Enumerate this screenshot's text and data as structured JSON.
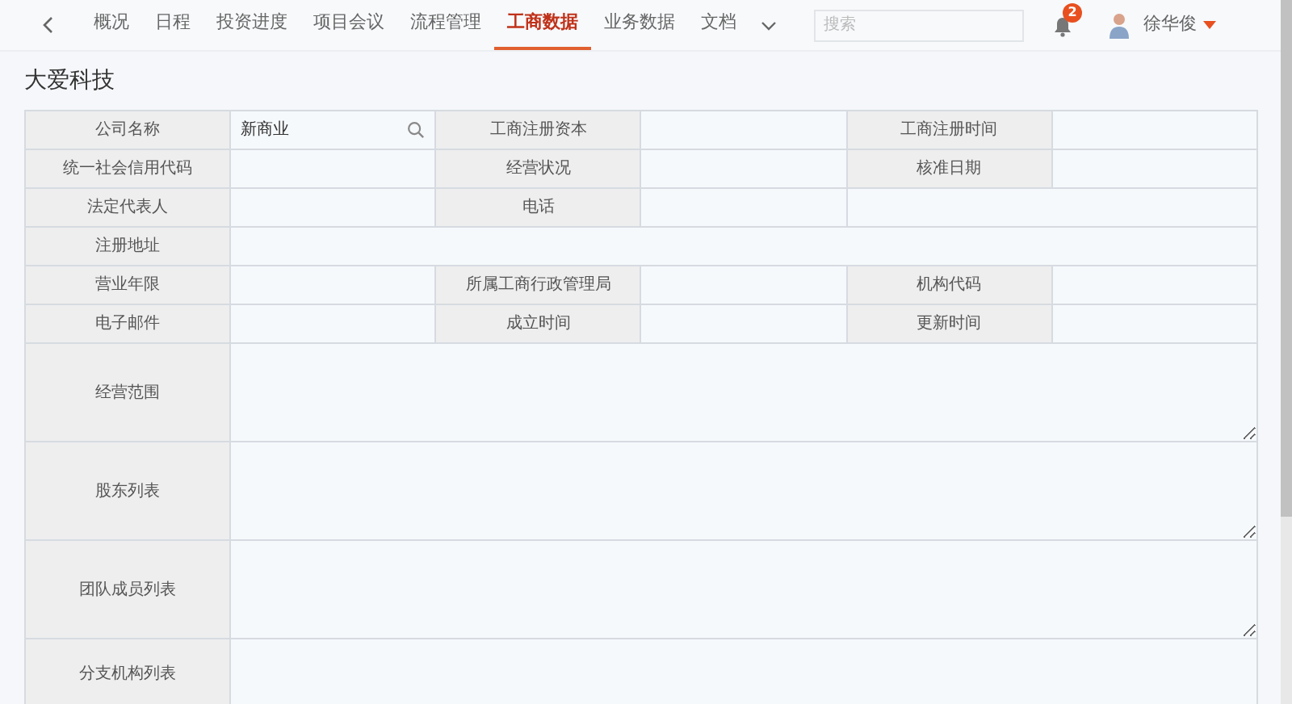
{
  "nav": {
    "tabs": [
      {
        "label": "概况",
        "selected": false
      },
      {
        "label": "日程",
        "selected": false
      },
      {
        "label": "投资进度",
        "selected": false
      },
      {
        "label": "项目会议",
        "selected": false
      },
      {
        "label": "流程管理",
        "selected": false
      },
      {
        "label": "工商数据",
        "selected": true
      },
      {
        "label": "业务数据",
        "selected": false
      },
      {
        "label": "文档",
        "selected": false
      }
    ],
    "search": {
      "placeholder": "搜索"
    },
    "notifications": {
      "badge": "2"
    },
    "user": {
      "name": "徐华俊"
    }
  },
  "title": "大爱科技",
  "table": {
    "rows": [
      {
        "cells": [
          {
            "kind": "label",
            "text": "公司名称"
          },
          {
            "kind": "search",
            "value": "新商业"
          },
          {
            "kind": "label",
            "text": "工商注册资本"
          },
          {
            "kind": "value"
          },
          {
            "kind": "label",
            "text": "工商注册时间"
          },
          {
            "kind": "value"
          }
        ]
      },
      {
        "cells": [
          {
            "kind": "label",
            "text": "统一社会信用代码"
          },
          {
            "kind": "value"
          },
          {
            "kind": "label",
            "text": "经营状况"
          },
          {
            "kind": "value"
          },
          {
            "kind": "label",
            "text": "核准日期"
          },
          {
            "kind": "value"
          }
        ]
      },
      {
        "cells": [
          {
            "kind": "label",
            "text": "法定代表人"
          },
          {
            "kind": "value"
          },
          {
            "kind": "label",
            "text": "电话"
          },
          {
            "kind": "value"
          },
          {
            "kind": "value_wide"
          }
        ]
      },
      {
        "cells": [
          {
            "kind": "label",
            "text": "注册地址"
          },
          {
            "kind": "value_full"
          }
        ]
      },
      {
        "cells": [
          {
            "kind": "label",
            "text": "营业年限"
          },
          {
            "kind": "value"
          },
          {
            "kind": "label",
            "text": "所属工商行政管理局"
          },
          {
            "kind": "value"
          },
          {
            "kind": "label",
            "text": "机构代码"
          },
          {
            "kind": "value"
          }
        ]
      },
      {
        "cells": [
          {
            "kind": "label",
            "text": "电子邮件"
          },
          {
            "kind": "value"
          },
          {
            "kind": "label",
            "text": "成立时间"
          },
          {
            "kind": "value"
          },
          {
            "kind": "label",
            "text": "更新时间"
          },
          {
            "kind": "value"
          }
        ]
      }
    ],
    "text_areas": [
      {
        "label": "经营范围"
      },
      {
        "label": "股东列表"
      },
      {
        "label": "团队成员列表"
      },
      {
        "label": "分支机构列表"
      }
    ]
  }
}
